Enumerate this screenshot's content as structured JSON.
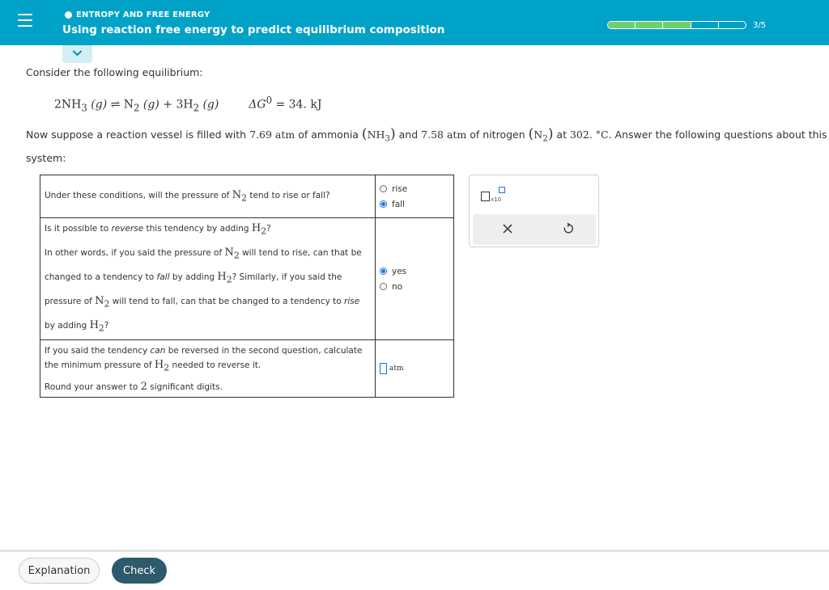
{
  "header": {
    "topic": "ENTROPY AND FREE ENERGY",
    "title": "Using reaction free energy to predict equilibrium composition",
    "progress": {
      "filled_segments": 3,
      "total_segments": 5,
      "label": "3/5"
    },
    "menu_icon": "hamburger-menu-icon",
    "collapse_icon": "chevron-down-icon"
  },
  "prompt": {
    "intro": "Consider the following equilibrium:",
    "equation": {
      "reactant_coef": "2",
      "reactant": "NH",
      "reactant_sub": "3",
      "phase": "(g)",
      "arrow": "⇌",
      "product1": "N",
      "product1_sub": "2",
      "plus": "+",
      "product2_coef": "3",
      "product2": "H",
      "product2_sub": "2",
      "delta_g_symbol": "ΔG",
      "delta_g_sup": "0",
      "delta_g_value": "= 34. kJ"
    },
    "scenario": {
      "part1": "Now suppose a reaction vessel is filled with ",
      "ammonia_pressure": "7.69 atm",
      "part2": " of ammonia ",
      "ammonia_formula": "NH",
      "ammonia_sub": "3",
      "part3": " and ",
      "nitrogen_pressure": "7.58 atm",
      "part4": " of nitrogen ",
      "nitrogen_formula": "N",
      "nitrogen_sub": "2",
      "part5": " at ",
      "temperature": "302. °C",
      "part6": ". Answer the following questions about this system:"
    }
  },
  "questions": {
    "q1": {
      "text_a": "Under these conditions, will the pressure of ",
      "species": "N",
      "species_sub": "2",
      "text_b": " tend to rise or fall?",
      "options": [
        "rise",
        "fall"
      ],
      "selected": "fall"
    },
    "q2": {
      "line1_a": "Is it possible to ",
      "line1_em": "reverse",
      "line1_b": " this tendency by adding ",
      "line1_species": "H",
      "line1_sub": "2",
      "line1_c": "?",
      "line2_a": "In other words, if you said the pressure of ",
      "line2_species": "N",
      "line2_sub": "2",
      "line2_b": " will tend to rise, can that be",
      "line3_a": "changed to a tendency to ",
      "line3_em": "fall",
      "line3_b": " by adding ",
      "line3_species": "H",
      "line3_sub": "2",
      "line3_c": "? Similarly, if you said the",
      "line4_a": "pressure of ",
      "line4_species": "N",
      "line4_sub": "2",
      "line4_b": " will tend to fall, can that be changed to a tendency to ",
      "line4_em": "rise",
      "line5_a": "by adding ",
      "line5_species": "H",
      "line5_sub": "2",
      "line5_b": "?",
      "options": [
        "yes",
        "no"
      ],
      "selected": "yes"
    },
    "q3": {
      "line1_a": "If you said the tendency ",
      "line1_em": "can",
      "line1_b": " be reversed in the second question, calculate",
      "line2_a": "the minimum pressure of ",
      "line2_species": "H",
      "line2_sub": "2",
      "line2_b": " needed to reverse it.",
      "line3_a": "Round your answer to ",
      "line3_num": "2",
      "line3_b": " significant digits.",
      "answer_value": "",
      "unit": "atm"
    }
  },
  "tools": {
    "x10_label": "x10",
    "clear_icon": "x-close-icon",
    "undo_icon": "undo-icon"
  },
  "footer": {
    "explanation_label": "Explanation",
    "check_label": "Check"
  },
  "colors": {
    "header_bg": "#00a3c7",
    "progress_fill": "#6fcf6a",
    "selected_radio": "#1a73e8",
    "check_button": "#2e5a6b"
  }
}
